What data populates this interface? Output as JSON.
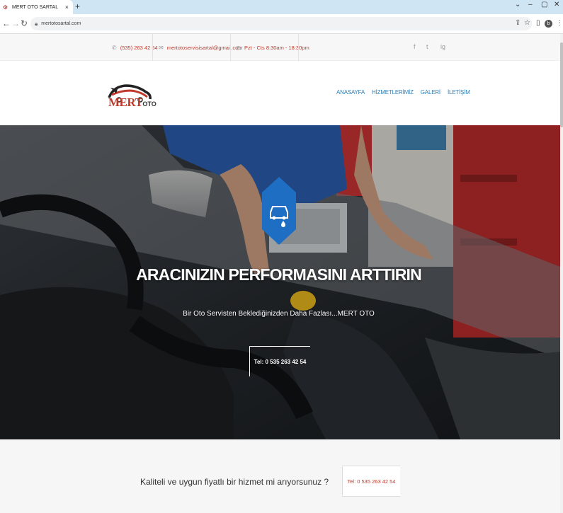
{
  "browser": {
    "tab_title": "MERT OTO SARTAL",
    "tab_close": "×",
    "new_tab": "+",
    "url": "mertotosartal.com",
    "window_controls": [
      "⌄",
      "–",
      "▢",
      "✕"
    ]
  },
  "infobar": {
    "phone": "(535) 263 42 54",
    "email": "mertotoservisisartal@gmail.com",
    "hours": "Pzt - Cts 8:30am - 18:30pm",
    "social": [
      "f",
      "t",
      "ig"
    ]
  },
  "logo": {
    "brand": "MERT",
    "brand_suffix": "OTO"
  },
  "nav": {
    "items": [
      "ANASAYFA",
      "HİZMETLERİMİZ",
      "GALERİ",
      "İLETİŞİM"
    ]
  },
  "hero": {
    "title": "ARACINIZIN PERFORMASINI ARTTIRIN",
    "subtitle": "Bir Oto Servisten Beklediğinizden Daha Fazlası...MERT OTO",
    "button": "Tel: 0 535 263 42 54"
  },
  "cta": {
    "text": "Kaliteli ve uygun fiyatlı bir hizmet mi arıyorsunuz ?",
    "button": "Tel: 0 535 263 42 54"
  },
  "colors": {
    "accent": "#c0392b",
    "nav_link": "#2c7fb8",
    "hex_badge": "#1e6fc4",
    "tabbar": "#cfe5f3"
  }
}
